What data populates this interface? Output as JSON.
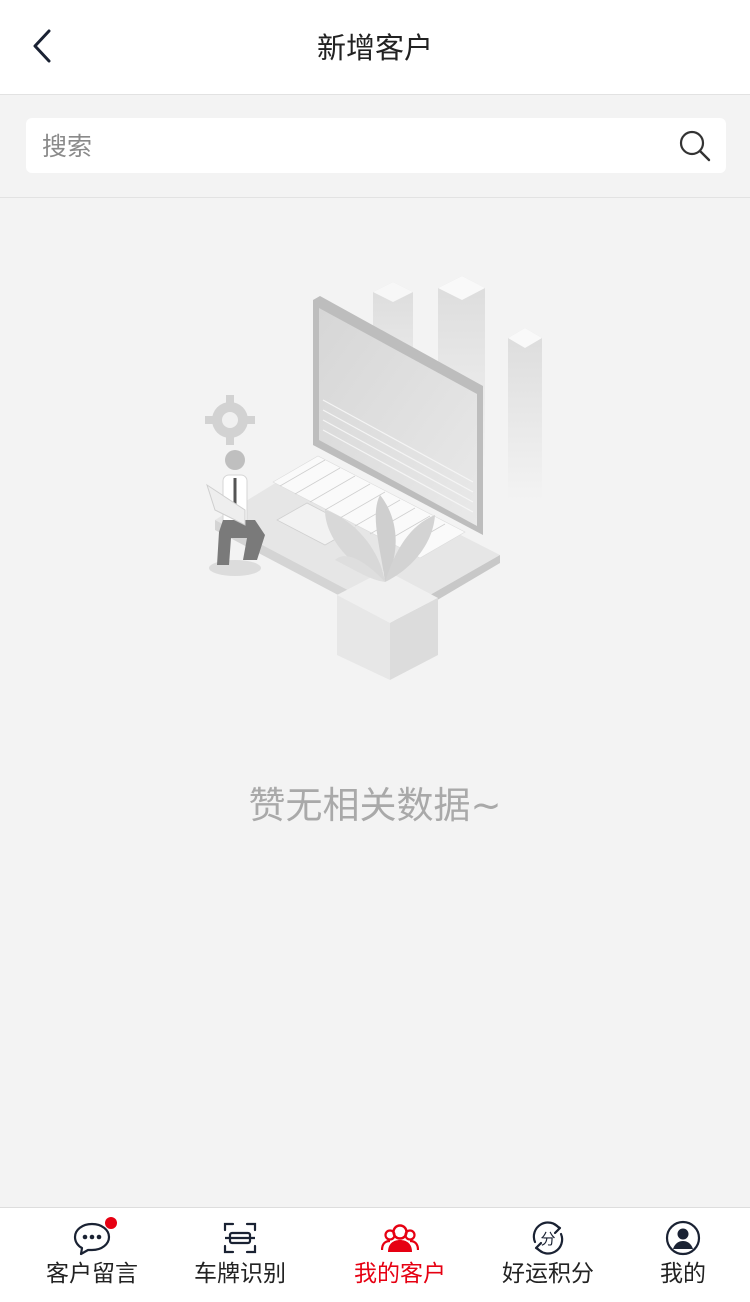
{
  "header": {
    "title": "新增客户"
  },
  "search": {
    "placeholder": "搜索"
  },
  "empty_state": {
    "message": "赞无相关数据~"
  },
  "tabbar": {
    "active_color": "#e60012",
    "items": [
      {
        "label": "客户留言",
        "icon": "chat-bubble-icon",
        "has_badge": true
      },
      {
        "label": "车牌识别",
        "icon": "license-plate-scan-icon"
      },
      {
        "label": "我的客户",
        "icon": "customers-group-icon",
        "active": true
      },
      {
        "label": "好运积分",
        "icon": "points-cycle-icon"
      },
      {
        "label": "我的",
        "icon": "user-profile-icon"
      }
    ]
  }
}
